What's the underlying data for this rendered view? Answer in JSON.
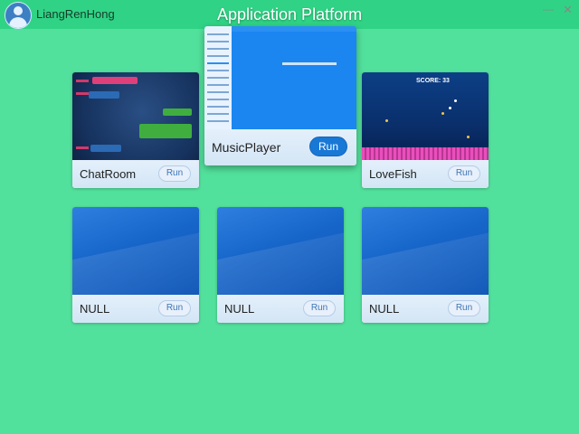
{
  "header": {
    "username": "LiangRenHong",
    "title": "Application Platform",
    "minimize_label": "—",
    "close_label": "✕"
  },
  "apps": {
    "chatroom": {
      "name": "ChatRoom",
      "run": "Run"
    },
    "musicplayer": {
      "name": "MusicPlayer",
      "run": "Run"
    },
    "lovefish": {
      "name": "LoveFish",
      "run": "Run",
      "score": "SCORE: 33"
    },
    "null1": {
      "name": "NULL",
      "run": "Run"
    },
    "null2": {
      "name": "NULL",
      "run": "Run"
    },
    "null3": {
      "name": "NULL",
      "run": "Run"
    }
  },
  "colors": {
    "background": "#52e19c",
    "topbar": "#30d385",
    "run_active": "#1878d6",
    "tile_blue": "#1665c9"
  },
  "icons": {
    "avatar": "user-avatar-icon",
    "minimize": "minimize-icon",
    "close": "close-icon"
  }
}
